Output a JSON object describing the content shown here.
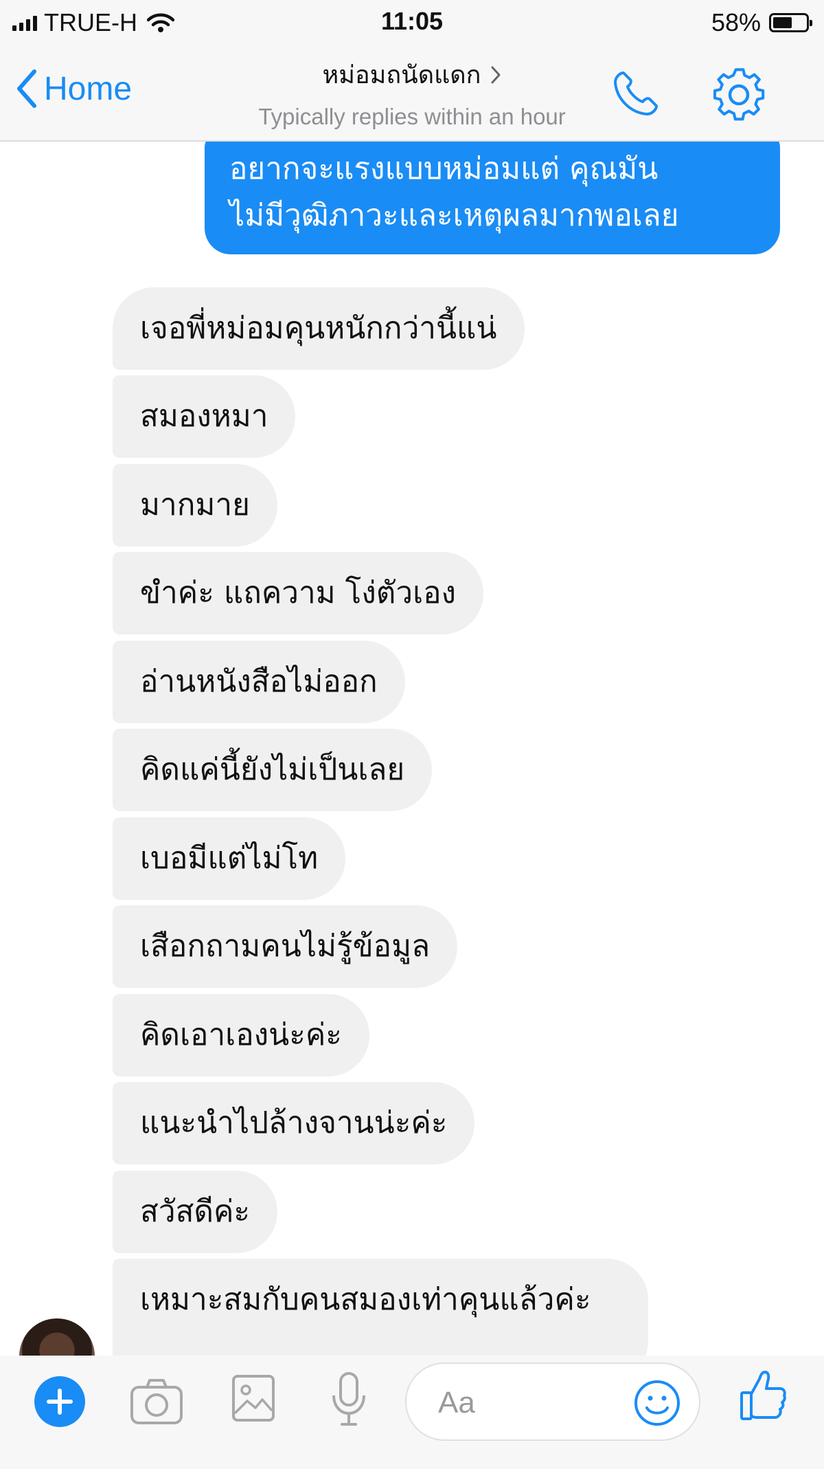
{
  "status_bar": {
    "carrier": "TRUE-H",
    "time": "11:05",
    "battery_percent": "58%",
    "battery_level": 0.58
  },
  "header": {
    "back_label": "Home",
    "title": "หม่อมถนัดแดก",
    "subtitle": "Typically replies within an hour"
  },
  "messages": {
    "outgoing": [
      {
        "lines": [
          "อยากจะแรงแบบหม่อมแต่ คุณมัน",
          "ไม่มีวุฒิภาวะและเหตุผลมากพอเลย"
        ]
      }
    ],
    "incoming": [
      "เจอพี่หม่อมคุนหนักกว่านี้แน่",
      "สมองหมา",
      "มากมาย",
      "ขำค่ะ แถความ โง่ตัวเอง",
      "อ่านหนังสือไม่ออก",
      "คิดแค่นี้ยังไม่เป็นเลย",
      "เบอมีแต่ไม่โท",
      "เสือกถามคนไม่รู้ข้อมูล",
      "คิดเอาเองน่ะค่ะ",
      "แนะนำไปล้างจานน่ะค่ะ",
      "สวัสดีค่ะ",
      "เหมาะสมกับคนสมองเท่าคุนแล้วค่ะ"
    ]
  },
  "composer": {
    "placeholder": "Aa"
  },
  "colors": {
    "accent": "#1a8cf5",
    "incoming_bubble": "#f0f0f0",
    "bar_background": "#f7f7f7"
  },
  "icons": {
    "back": "chevron-left-icon",
    "call": "phone-icon",
    "settings": "gear-icon",
    "more": "plus-icon",
    "camera": "camera-icon",
    "gallery": "image-icon",
    "voice": "microphone-icon",
    "emoji": "smiley-icon",
    "like": "thumbs-up-icon"
  }
}
